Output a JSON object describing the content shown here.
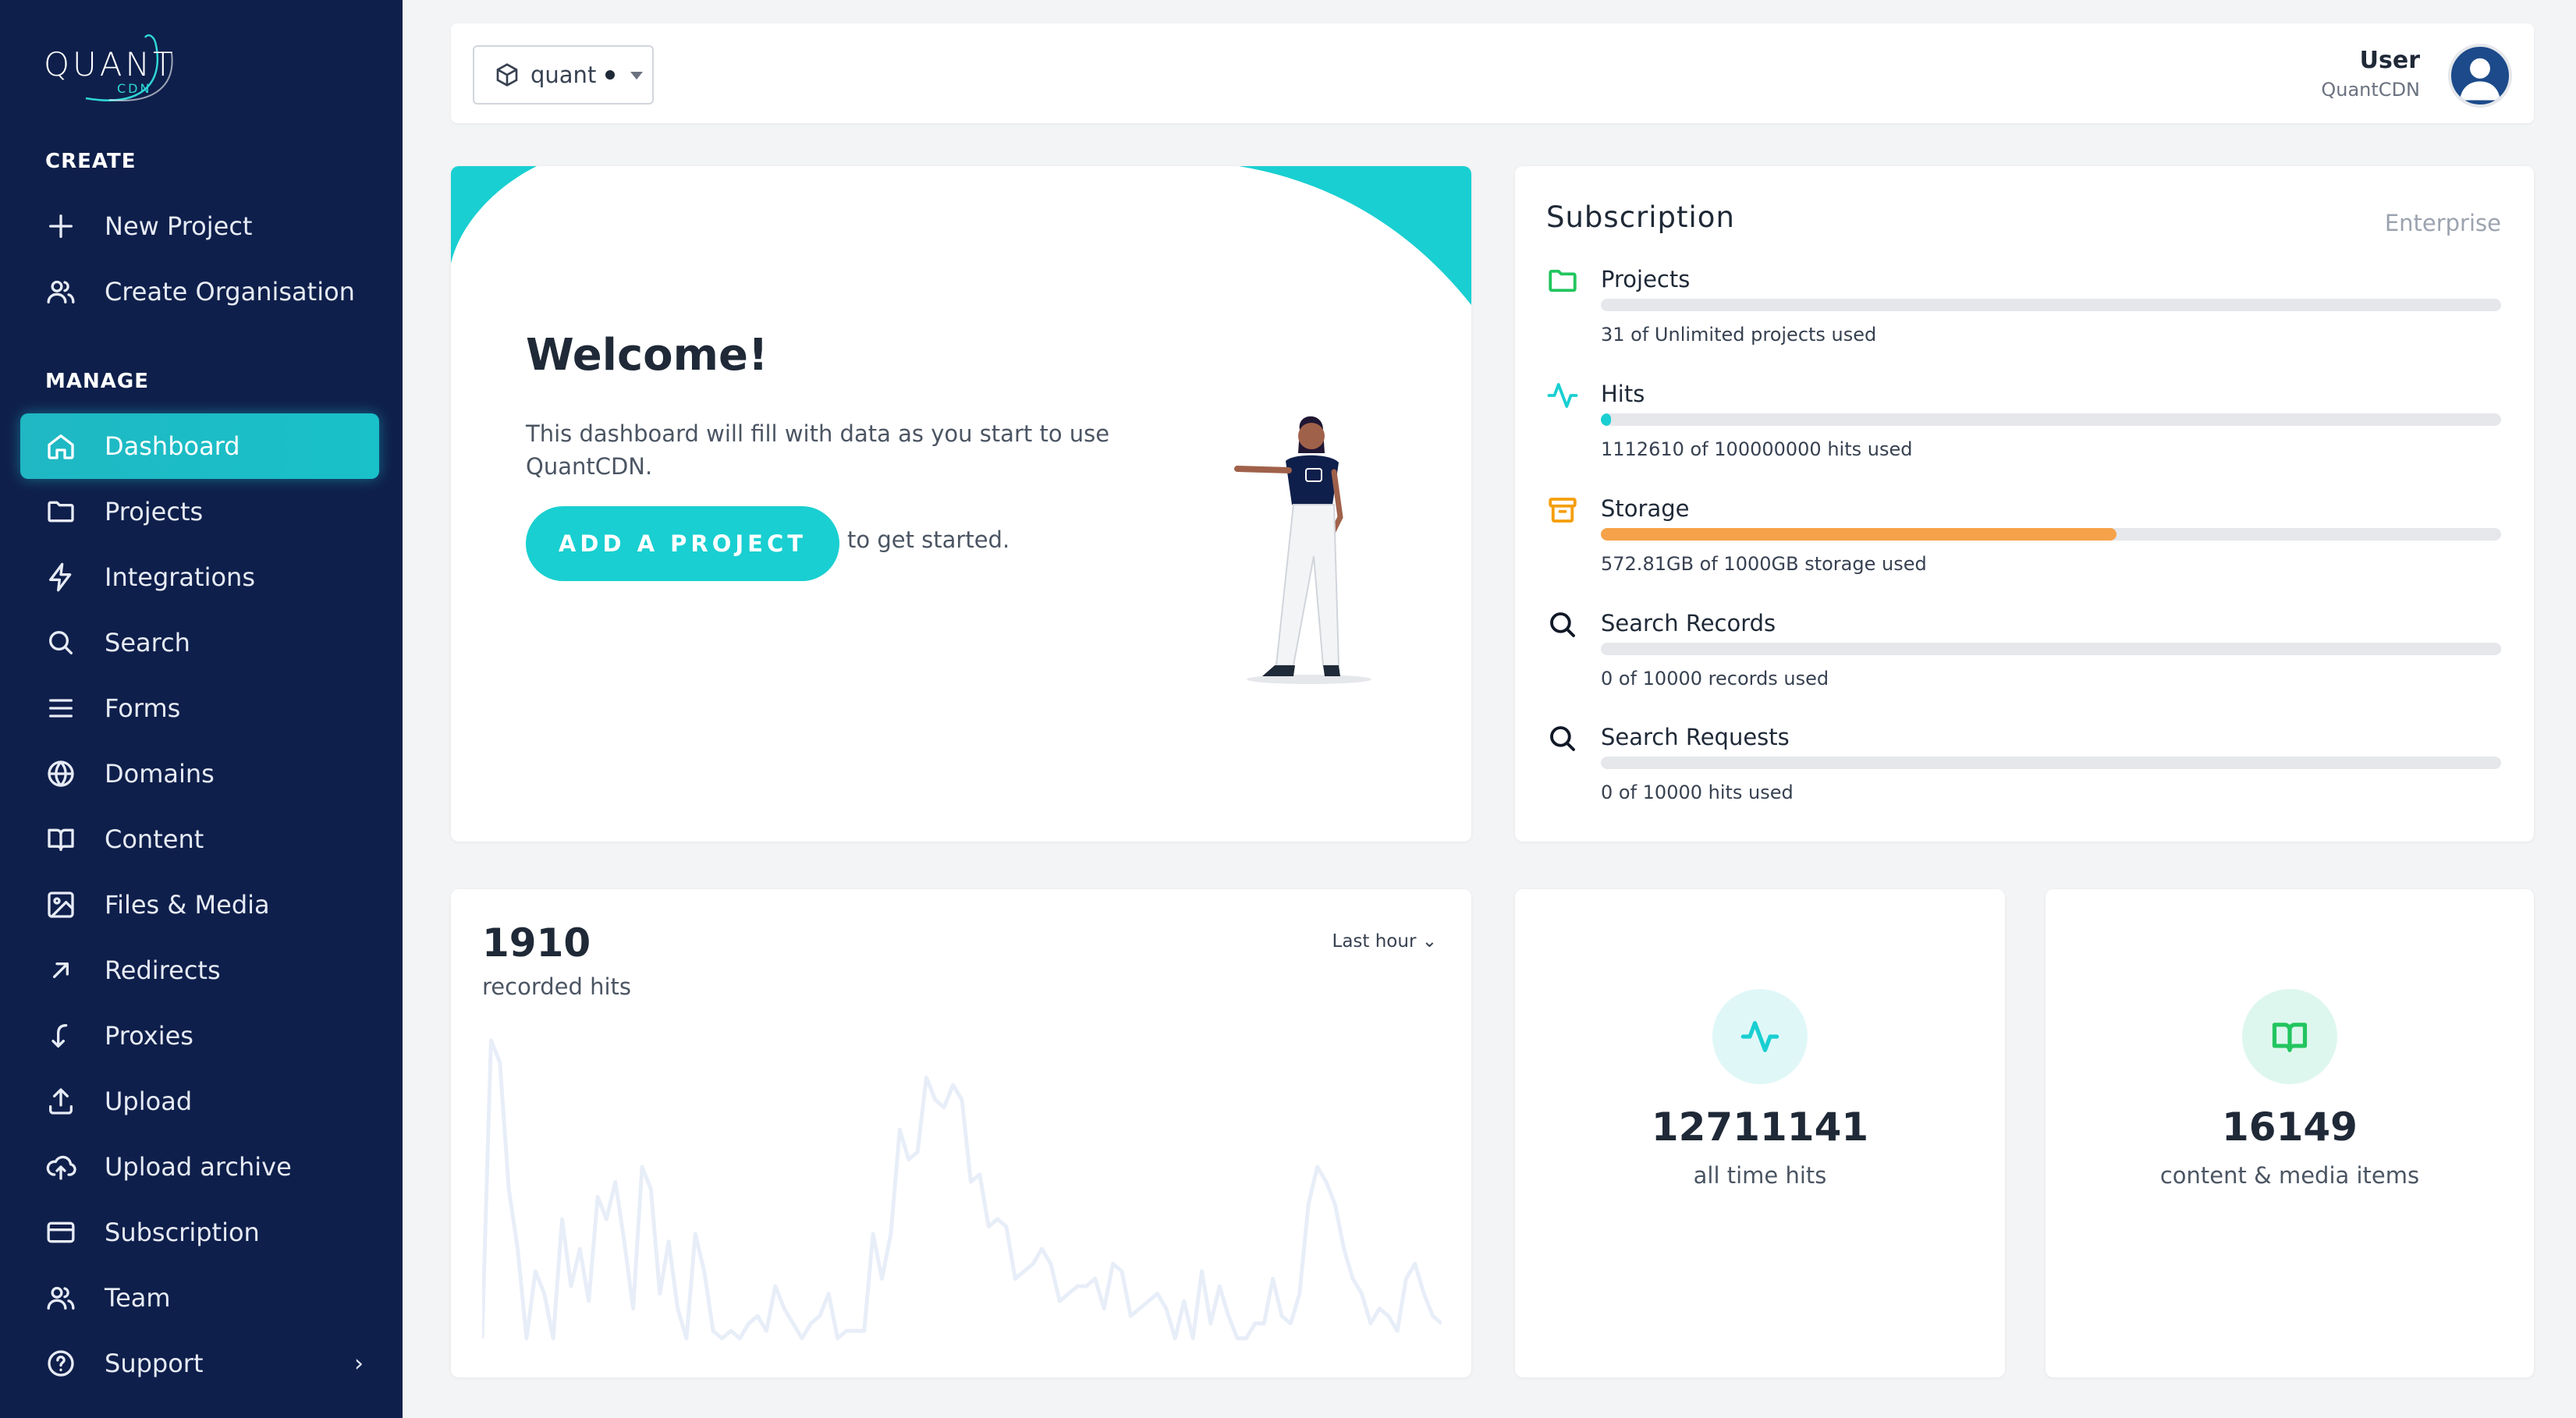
{
  "app": {
    "logo_word": "QUANT",
    "logo_sub": "CDN"
  },
  "colors": {
    "sidebar_bg": "#0f1f4b",
    "accent": "#19cfd1",
    "storage_bar": "#f6a24a",
    "hits_line": "#e8eef8"
  },
  "sidebar": {
    "create_label": "CREATE",
    "create_items": [
      {
        "label": "New Project",
        "icon": "plus-icon"
      },
      {
        "label": "Create Organisation",
        "icon": "users-icon"
      }
    ],
    "manage_label": "MANAGE",
    "manage_items": [
      {
        "label": "Dashboard",
        "icon": "home-icon",
        "active": true
      },
      {
        "label": "Projects",
        "icon": "folder-icon"
      },
      {
        "label": "Integrations",
        "icon": "lightning-icon"
      },
      {
        "label": "Search",
        "icon": "search-icon"
      },
      {
        "label": "Forms",
        "icon": "menu-icon"
      },
      {
        "label": "Domains",
        "icon": "globe-icon"
      },
      {
        "label": "Content",
        "icon": "book-icon"
      },
      {
        "label": "Files & Media",
        "icon": "image-icon"
      },
      {
        "label": "Redirects",
        "icon": "arrow-up-right-icon"
      },
      {
        "label": "Proxies",
        "icon": "arrow-down-left-icon"
      },
      {
        "label": "Upload",
        "icon": "upload-icon"
      },
      {
        "label": "Upload archive",
        "icon": "cloud-upload-icon"
      },
      {
        "label": "Subscription",
        "icon": "credit-card-icon"
      },
      {
        "label": "Team",
        "icon": "users-icon"
      },
      {
        "label": "Support",
        "icon": "question-icon"
      }
    ]
  },
  "topbar": {
    "org_selected": "quant",
    "user_name": "User",
    "user_org": "QuantCDN"
  },
  "welcome": {
    "title": "Welcome!",
    "description": "This dashboard will fill with data as you start to use QuantCDN.",
    "button_label": "ADD A PROJECT",
    "after_button": "to get started."
  },
  "subscription": {
    "title": "Subscription",
    "plan": "Enterprise",
    "items": [
      {
        "label": "Projects",
        "note": "31 of Unlimited projects used",
        "fraction": 0.0,
        "icon": "folder-icon",
        "icon_color": "#22c55e",
        "bar_color": "#19cfd1"
      },
      {
        "label": "Hits",
        "note": "1112610 of 100000000 hits used",
        "fraction": 0.011,
        "icon": "activity-icon",
        "icon_color": "#19cfd1",
        "bar_color": "#19cfd1"
      },
      {
        "label": "Storage",
        "note": "572.81GB of 1000GB storage used",
        "fraction": 0.573,
        "icon": "archive-icon",
        "icon_color": "#f59e0b",
        "bar_color": "#f6a24a"
      },
      {
        "label": "Search Records",
        "note": "0 of 10000 records used",
        "fraction": 0.0,
        "icon": "search-icon",
        "icon_color": "#111827",
        "bar_color": "#19cfd1"
      },
      {
        "label": "Search Requests",
        "note": "0 of 10000 hits used",
        "fraction": 0.0,
        "icon": "search-icon",
        "icon_color": "#111827",
        "bar_color": "#19cfd1"
      }
    ]
  },
  "hits_panel": {
    "value": "1910",
    "caption": "recorded hits",
    "range": "Last hour"
  },
  "chart_data": {
    "type": "line",
    "series": [
      {
        "values": [
          20,
          420,
          390,
          220,
          140,
          20,
          110,
          80,
          20,
          180,
          90,
          140,
          70,
          210,
          180,
          230,
          150,
          60,
          250,
          220,
          80,
          150,
          60,
          20,
          160,
          110,
          30,
          20,
          30,
          20,
          40,
          50,
          30,
          90,
          60,
          40,
          20,
          40,
          50,
          80,
          20,
          30,
          30,
          30,
          160,
          100,
          160,
          300,
          260,
          270,
          370,
          340,
          330,
          360,
          340,
          230,
          240,
          170,
          180,
          170,
          100,
          110,
          120,
          140,
          120,
          70,
          80,
          90,
          90,
          100,
          60,
          120,
          110,
          50,
          60,
          70,
          80,
          60,
          20,
          70,
          20,
          110,
          40,
          90,
          50,
          20,
          20,
          40,
          40,
          100,
          50,
          40,
          80,
          200,
          250,
          230,
          200,
          140,
          100,
          80,
          40,
          60,
          50,
          30,
          100,
          120,
          80,
          50,
          40
        ]
      }
    ],
    "ylim": [
      0,
      450
    ],
    "grid": false
  },
  "stats": [
    {
      "value": "12711141",
      "label": "all time hits",
      "icon": "activity-icon",
      "circle_bg": "#e0f7f7",
      "icon_color": "#19cfd1"
    },
    {
      "value": "16149",
      "label": "content & media items",
      "icon": "book-icon",
      "circle_bg": "#def7ee",
      "icon_color": "#22c55e"
    }
  ]
}
